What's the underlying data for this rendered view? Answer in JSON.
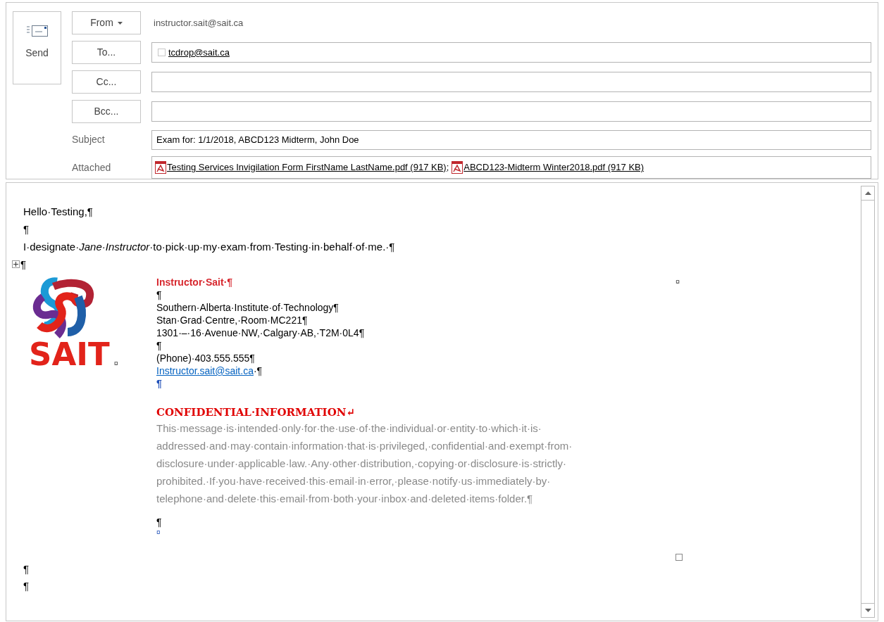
{
  "send_button": {
    "label": "Send"
  },
  "fields": [
    {
      "kind": "from",
      "label": "From",
      "value": "instructor.sait@sait.ca"
    },
    {
      "kind": "recipients",
      "label": "To...",
      "recipients": [
        "tcdrop@sait.ca"
      ]
    },
    {
      "kind": "recipients",
      "label": "Cc..."
    },
    {
      "kind": "recipients",
      "label": "Bcc..."
    },
    {
      "kind": "subject",
      "label": "Subject",
      "value": "Exam for: 1/1/2018, ABCD123 Midterm, John Doe"
    },
    {
      "kind": "attached",
      "label": "Attached",
      "separator": ";",
      "files": [
        "Testing Services Invigilation Form FirstName LastName.pdf (917 KB)",
        "ABCD123-Midterm Winter2018.pdf (917 KB)"
      ]
    }
  ],
  "body": {
    "lines_before": [
      "Hello·Testing,¶",
      "¶",
      "I·designate·*Jane·Instructor*·to·pick·up·my·exam·from·Testing·in·behalf·of·me.·¶",
      "¶"
    ],
    "signature": {
      "logo": {
        "text": "SAIT",
        "cell_mark": "¤"
      },
      "end_cell_mark": "¤",
      "lines": [
        {
          "kind": "name",
          "text": "Instructor·Sait·¶"
        },
        {
          "kind": "plain",
          "text": "¶"
        },
        {
          "kind": "plain",
          "text": "Southern·Alberta·Institute·of·Technology¶"
        },
        {
          "kind": "plain",
          "text": "Stan·Grad·Centre,·Room·MC221¶"
        },
        {
          "kind": "plain",
          "text": "1301·–·16·Avenue·NW,·Calgary·AB,·T2M·0L4¶"
        },
        {
          "kind": "plain",
          "text": "¶"
        },
        {
          "kind": "plain",
          "text": "(Phone)·403.555.555¶"
        },
        {
          "kind": "link",
          "text": "Instructor.sait@sait.ca",
          "mark": "·¶"
        },
        {
          "kind": "blue_mark",
          "text": "¶"
        },
        {
          "kind": "heading",
          "text": "CONFIDENTIAL·INFORMATION↵"
        },
        {
          "kind": "disclaimer",
          "lines": [
            "This·message·is·intended·only·for·the·use·of·the·individual·or·entity·to·which·it·is·",
            "addressed·and·may·contain·information·that·is·privileged,·confidential·and·exempt·from·",
            "disclosure·under·applicable·law.·Any·other·distribution,·copying·or·disclosure·is·strictly·",
            "prohibited.·If·you·have·received·this·email·in·error,·please·notify·us·immediately·by·",
            "telephone·and·delete·this·email·from·both·your·inbox·and·deleted·items·folder.¶"
          ]
        },
        {
          "kind": "plain",
          "text": "¶"
        },
        {
          "kind": "cell_mark",
          "text": "¤"
        }
      ]
    },
    "lines_after": [
      "¶",
      "¶"
    ]
  }
}
